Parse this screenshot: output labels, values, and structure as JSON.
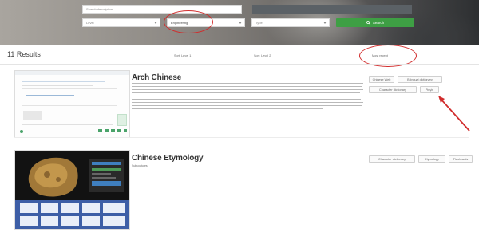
{
  "search": {
    "keyword_placeholder": "Search description",
    "title_bar": "",
    "level_value": "Level",
    "subject_value": "Engineering",
    "type_value": "Type",
    "search_label": "Search"
  },
  "results": {
    "count_label": "11 Results",
    "sort_options": [
      "Sort: Level 1",
      "Sort: Level 2",
      "Most recent"
    ]
  },
  "items": [
    {
      "title": "Arch Chinese",
      "tags": [
        "Chinese Web",
        "Bilingual dictionary",
        "Character dictionary",
        "Pinyin"
      ]
    },
    {
      "title": "Chinese Etymology",
      "subtitle": "Sub-cultures",
      "tags": [
        "Character dictionary",
        "Etymology",
        "Flashcards"
      ]
    }
  ],
  "annotations": {
    "highlight_color": "#d12c2c"
  },
  "colors": {
    "accent_green": "#3e9f44",
    "hero_dark": "#2d2f31"
  }
}
